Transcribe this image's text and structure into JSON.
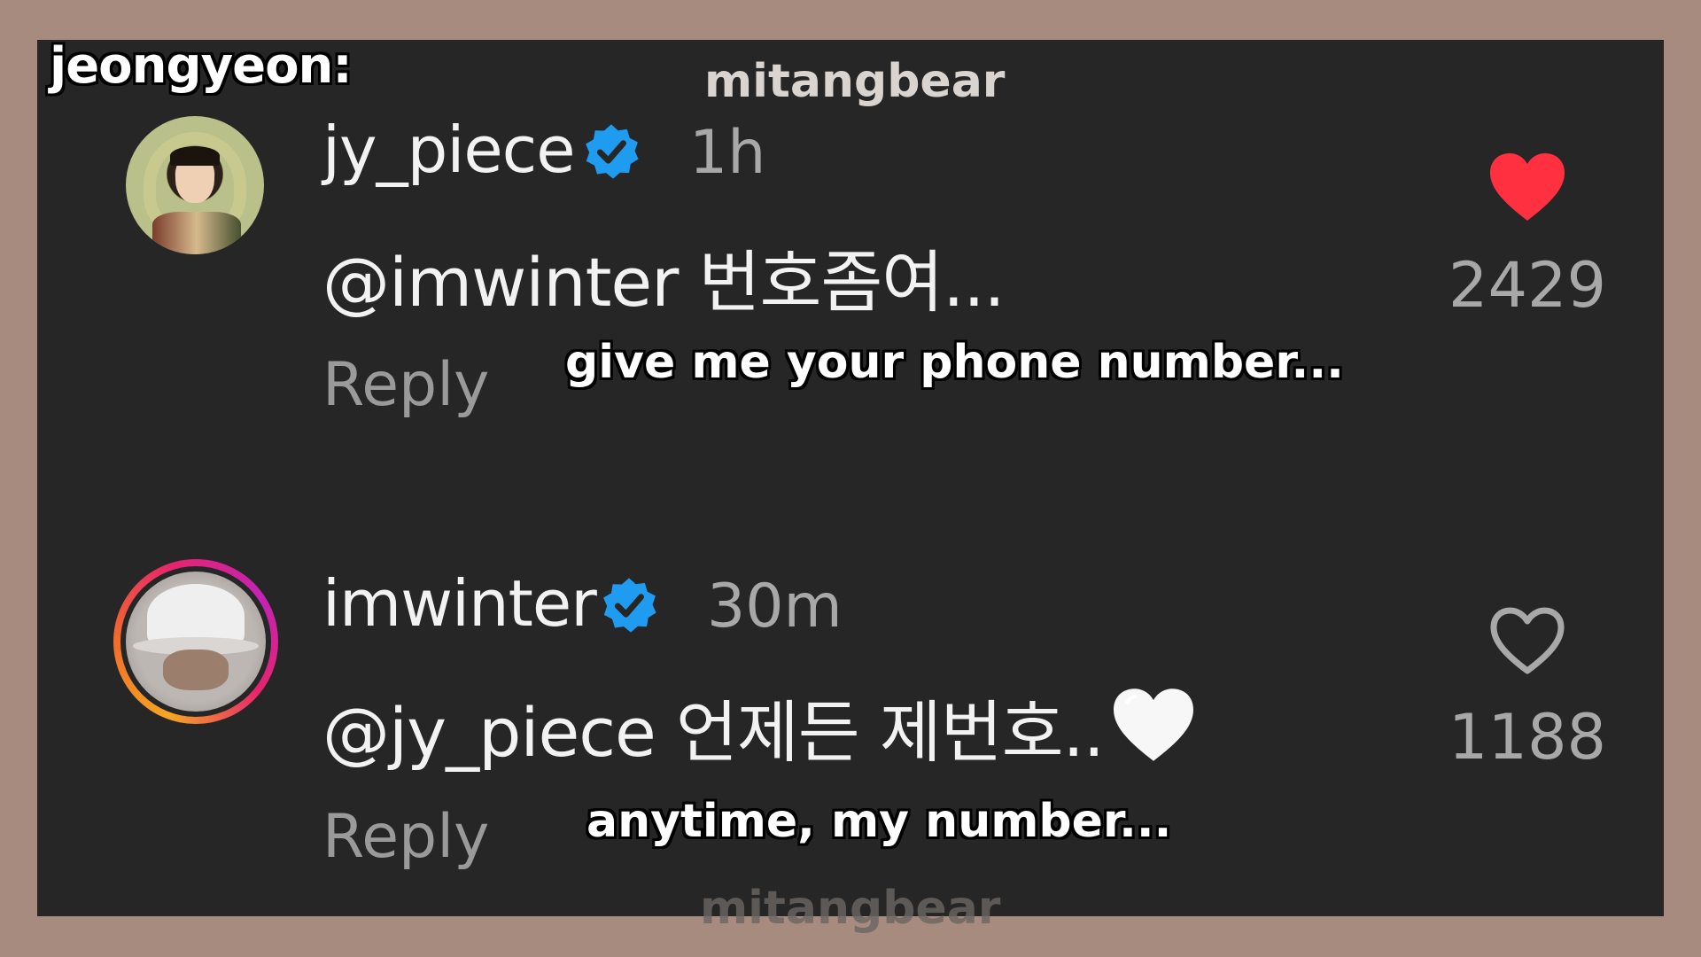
{
  "overlay": {
    "speaker_label": "jeongyeon:",
    "watermark_top": "mitangbear",
    "watermark_bottom": "mitangbear"
  },
  "comments": [
    {
      "username": "jy_piece",
      "verified": true,
      "time": "1h",
      "text": "@imwinter 번호좀여...",
      "reply_label": "Reply",
      "caption": "give me your phone number...",
      "liked": true,
      "likes": "2429",
      "avatar_icon": "profile-photo-icon"
    },
    {
      "username": "imwinter",
      "verified": true,
      "time": "30m",
      "text": "@jy_piece 언제든 제번호..",
      "text_emoji": "white-heart-emoji",
      "reply_label": "Reply",
      "caption": "anytime, my number...",
      "liked": false,
      "likes": "1188",
      "avatar_icon": "story-ring-profile-photo-icon"
    }
  ],
  "colors": {
    "frame": "#a68b7e",
    "panel": "#262626",
    "verified_blue": "#1f9bf0",
    "like_red": "#ff3040",
    "muted_text": "#a8a8a8"
  }
}
